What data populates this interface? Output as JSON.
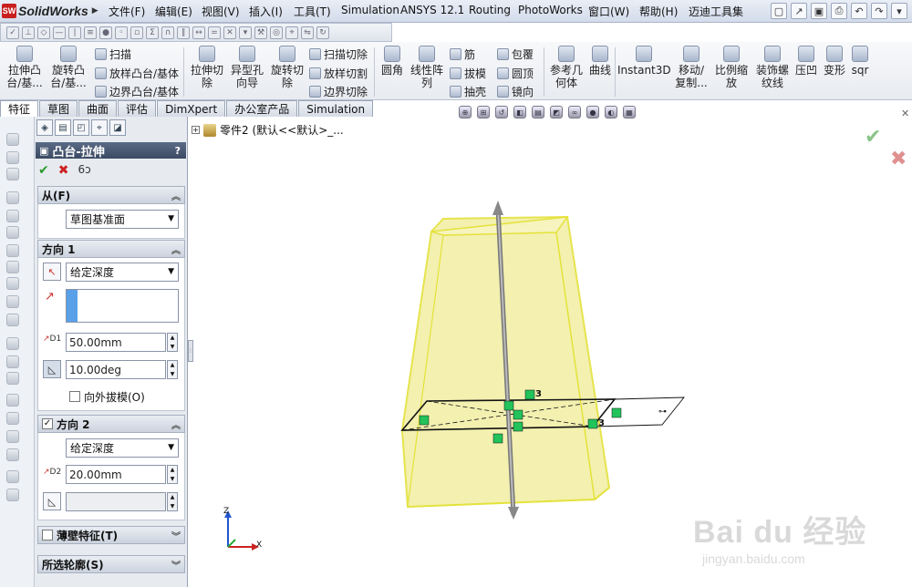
{
  "app": {
    "name": "SolidWorks",
    "logo_mark": "SW"
  },
  "menu": [
    "文件(F)",
    "编辑(E)",
    "视图(V)",
    "插入(I)",
    "工具(T)",
    "Simulation",
    "ANSYS 12.1",
    "Routing",
    "PhotoWorks",
    "窗口(W)",
    "帮助(H)",
    "迈迪工具集"
  ],
  "command_manager": {
    "large": [
      {
        "label": "拉伸凸\n台/基...",
        "icon": "extrude-boss-icon"
      },
      {
        "label": "旋转凸\n台/基...",
        "icon": "revolve-boss-icon"
      },
      {
        "label": "拉伸切\n除",
        "icon": "extrude-cut-icon"
      },
      {
        "label": "异型孔\n向导",
        "icon": "hole-wizard-icon"
      },
      {
        "label": "旋转切\n除",
        "icon": "revolve-cut-icon"
      },
      {
        "label": "圆角",
        "icon": "fillet-icon"
      },
      {
        "label": "线性阵\n列",
        "icon": "linear-pattern-icon"
      },
      {
        "label": "参考几\n何体",
        "icon": "reference-geometry-icon"
      },
      {
        "label": "曲线",
        "icon": "curves-icon"
      },
      {
        "label": "Instant3D",
        "icon": "instant3d-icon"
      },
      {
        "label": "移动/\n复制...",
        "icon": "move-copy-icon"
      },
      {
        "label": "比例缩\n放",
        "icon": "scale-icon"
      },
      {
        "label": "装饰螺\n纹线",
        "icon": "cosmetic-thread-icon"
      },
      {
        "label": "压凹",
        "icon": "indent-icon"
      },
      {
        "label": "变形",
        "icon": "deform-icon"
      },
      {
        "label": "sqr",
        "icon": "sqr-icon"
      }
    ],
    "small": [
      {
        "label": "扫描",
        "icon": "sweep-icon"
      },
      {
        "label": "放样凸台/基体",
        "icon": "loft-icon"
      },
      {
        "label": "边界凸台/基体",
        "icon": "boundary-boss-icon"
      },
      {
        "label": "扫描切除",
        "icon": "swept-cut-icon"
      },
      {
        "label": "放样切割",
        "icon": "lofted-cut-icon"
      },
      {
        "label": "边界切除",
        "icon": "boundary-cut-icon"
      },
      {
        "label": "筋",
        "icon": "rib-icon"
      },
      {
        "label": "拔模",
        "icon": "draft-icon"
      },
      {
        "label": "抽壳",
        "icon": "shell-icon"
      },
      {
        "label": "包覆",
        "icon": "wrap-icon"
      },
      {
        "label": "圆顶",
        "icon": "dome-icon"
      },
      {
        "label": "镜向",
        "icon": "mirror-icon"
      }
    ]
  },
  "tabs": [
    "特征",
    "草图",
    "曲面",
    "评估",
    "DimXpert",
    "办公室产品",
    "Simulation"
  ],
  "tree": {
    "root": "零件2  (默认<<默认>_..."
  },
  "property_manager": {
    "title": "凸台-拉伸",
    "help": "?",
    "from": {
      "heading": "从(F)",
      "value": "草图基准面"
    },
    "direction1": {
      "heading": "方向 1",
      "end_condition": "给定深度",
      "depth": "50.00mm",
      "depth_symbol": "D1",
      "draft_angle": "10.00deg",
      "draft_outward": "向外拔模(O)",
      "draft_outward_checked": false
    },
    "direction2": {
      "heading": "方向 2",
      "checked": true,
      "end_condition": "给定深度",
      "depth": "20.00mm",
      "depth_symbol": "D2",
      "draft_angle": ""
    },
    "thin_feature": {
      "heading": "薄壁特征(T)",
      "checked": false
    },
    "selected_contours": {
      "heading": "所选轮廓(S)"
    }
  },
  "triad": {
    "x": "X",
    "z": "Z"
  },
  "sketch_relations": [
    "3",
    "3"
  ],
  "watermark": {
    "brand": "Bai du 经验",
    "url": "jingyan.baidu.com"
  },
  "colors": {
    "model_fill": "#f2efa8",
    "model_edge": "#e4e23a",
    "sketch_line": "#111111",
    "relation_green": "#22c35a",
    "title_bar": "#3b4a63"
  }
}
